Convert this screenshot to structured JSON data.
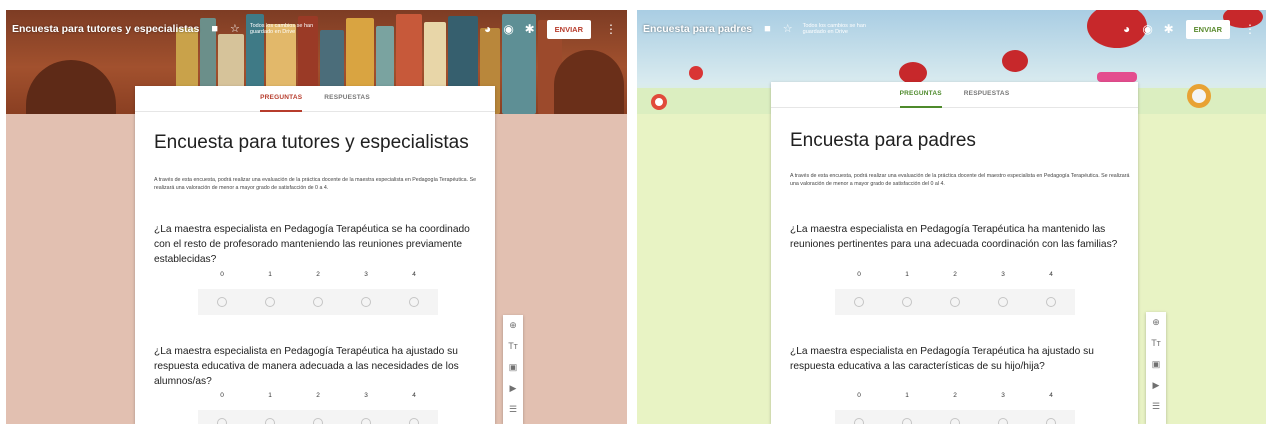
{
  "left": {
    "form_name": "Encuesta para tutores y especialistas",
    "saved_status": "Todos los cambios se han guardado en Drive",
    "send_label": "ENVIAR",
    "tabs": [
      "PREGUNTAS",
      "RESPUESTAS"
    ],
    "active_tab": "PREGUNTAS",
    "title": "Encuesta para tutores y especialistas",
    "description": "A través de esta encuesta, podrá realizar una evaluación de la práctica docente de la maestra especialista en Pedagogía Terapéutica. Se realizará una valoración de menor a mayor grado de satisfacción de 0 a 4.",
    "questions": [
      {
        "text": "¿La maestra especialista en Pedagogía Terapéutica se ha coordinado con el resto de profesorado manteniendo las reuniones previamente establecidas?",
        "scale": [
          "0",
          "1",
          "2",
          "3",
          "4"
        ]
      },
      {
        "text": "¿La maestra especialista en Pedagogía Terapéutica ha ajustado su respuesta educativa de manera adecuada a las necesidades de los alumnos/as?",
        "scale": [
          "0",
          "1",
          "2",
          "3",
          "4"
        ]
      }
    ],
    "theme_color": "#b73c2c",
    "background_color": "#e2c0b1"
  },
  "right": {
    "form_name": "Encuesta para padres",
    "saved_status": "Todos los cambios se han guardado en Drive",
    "send_label": "ENVIAR",
    "tabs": [
      "PREGUNTAS",
      "RESPUESTAS"
    ],
    "active_tab": "PREGUNTAS",
    "title": "Encuesta para padres",
    "description": "A través de esta encuesta, podrá realizar una evaluación de la práctica docente del maestro especialista en Pedagogía Terapéutica. Se realizará una valoración de menor a mayor grado de satisfacción del 0 al 4.",
    "questions": [
      {
        "text": "¿La maestra especialista en Pedagogía Terapéutica ha mantenido las reuniones pertinentes para una adecuada coordinación con las familias?",
        "scale": [
          "0",
          "1",
          "2",
          "3",
          "4"
        ]
      },
      {
        "text": "¿La maestra especialista en Pedagogía Terapéutica ha ajustado su respuesta educativa a las características de su hijo/hija?",
        "scale": [
          "0",
          "1",
          "2",
          "3",
          "4"
        ]
      }
    ],
    "theme_color": "#4d8a2b",
    "background_color": "#e8f3c4"
  },
  "toolbar_icons": [
    "folder-icon",
    "star-icon",
    "palette-icon",
    "eye-icon",
    "gear-icon",
    "more-vert-icon"
  ],
  "side_tools": [
    "add-question-icon",
    "add-title-icon",
    "add-image-icon",
    "add-video-icon",
    "add-section-icon"
  ]
}
